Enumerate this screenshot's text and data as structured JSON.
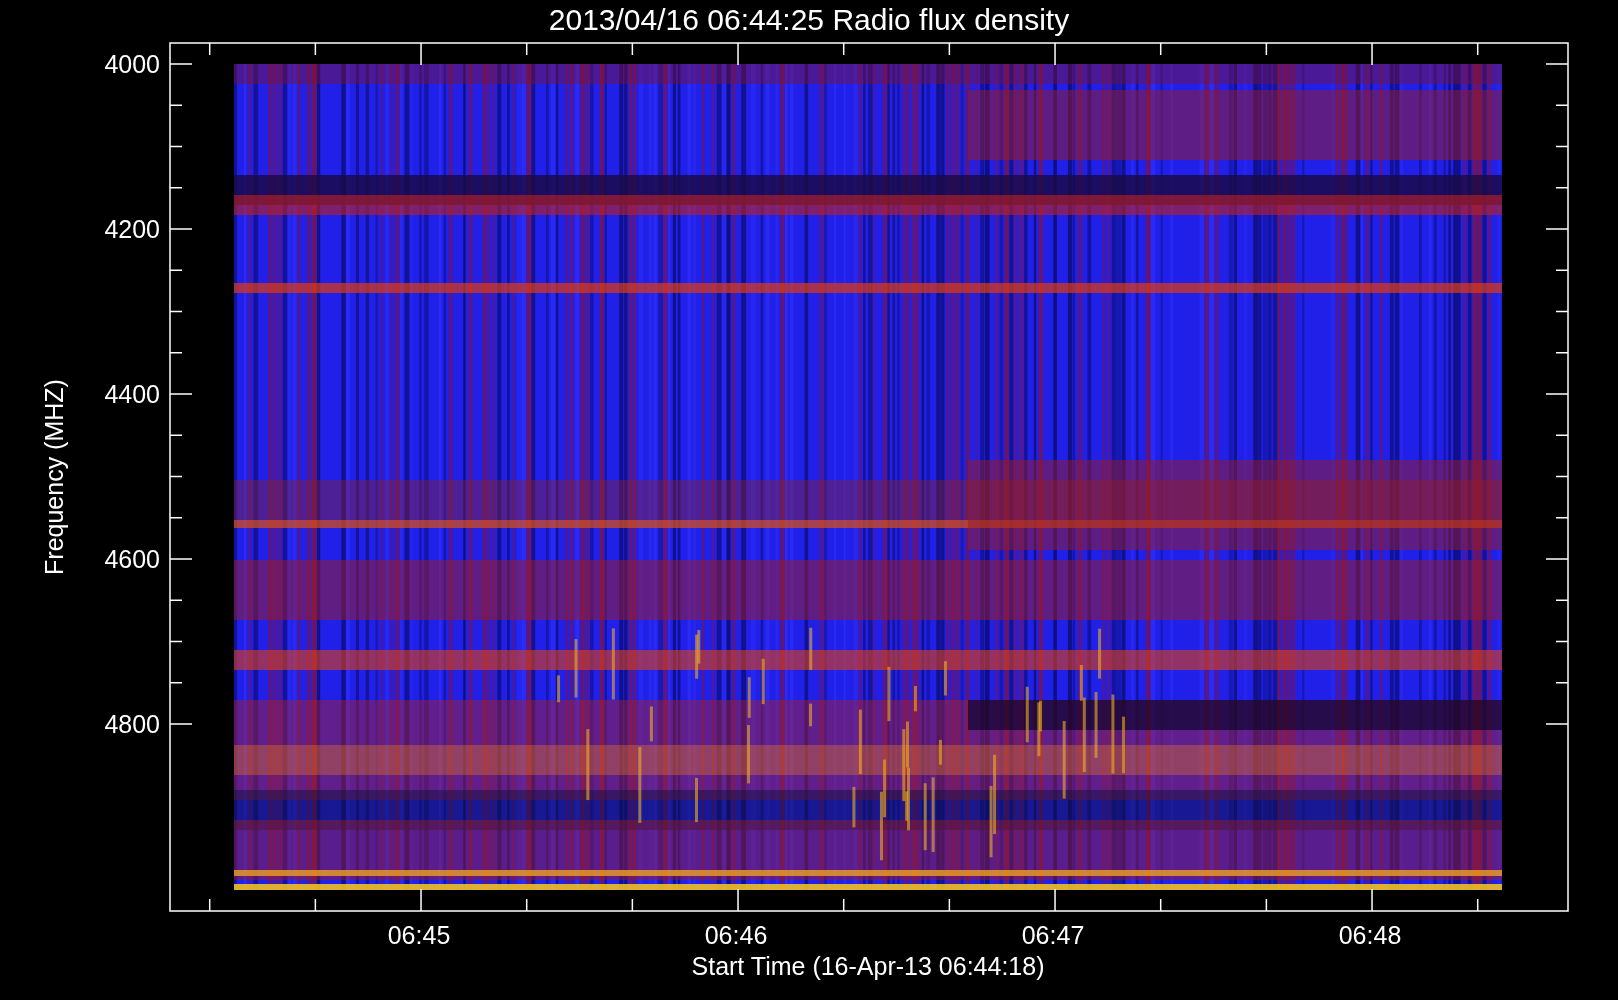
{
  "title": "2013/04/16 06:44:25 Radio flux density",
  "y_axis": {
    "label": "Frequency (MHZ)",
    "ticks": [
      "4000",
      "4200",
      "4400",
      "4600",
      "4800"
    ]
  },
  "x_axis": {
    "label": "Start Time (16-Apr-13 06:44:18)",
    "ticks": [
      "06:45",
      "06:46",
      "06:47",
      "06:48"
    ]
  }
}
